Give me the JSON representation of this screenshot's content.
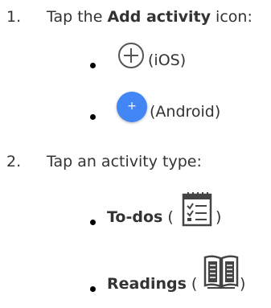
{
  "steps": [
    {
      "number": "1.",
      "text_before": "Tap the ",
      "bold": "Add activity",
      "text_after": " icon:",
      "items": [
        {
          "label": "(iOS)",
          "icon": "circled-plus-icon"
        },
        {
          "label": "(Android)",
          "icon": "blue-plus-button-icon",
          "color": "#4285f4"
        }
      ]
    },
    {
      "number": "2.",
      "text": "Tap an activity type:",
      "items": [
        {
          "bold": "To-dos",
          "paren_open": " (",
          "paren_close": ")",
          "icon": "checklist-icon"
        },
        {
          "bold": "Readings",
          "paren_open": " (",
          "paren_close": ")",
          "icon": "book-icon"
        }
      ]
    }
  ]
}
